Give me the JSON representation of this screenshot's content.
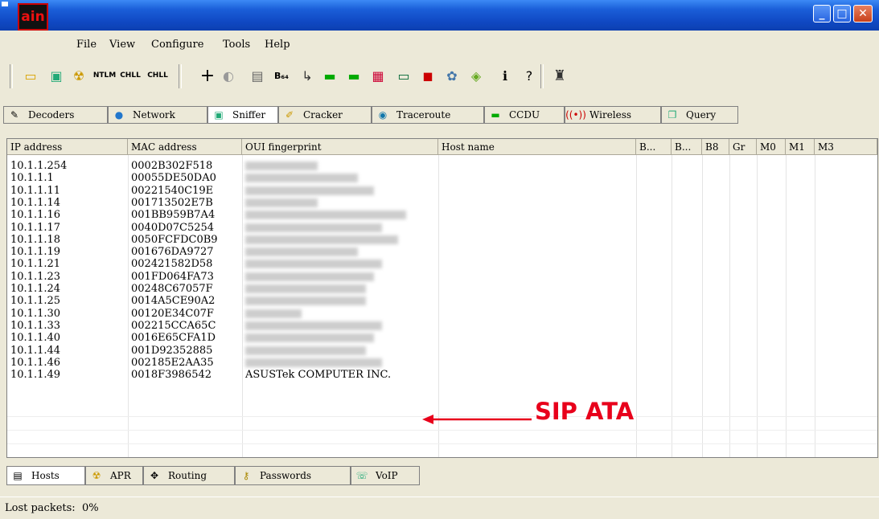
{
  "window": {
    "logo_text": "ain"
  },
  "menu": [
    "File",
    "View",
    "Configure",
    "Tools",
    "Help"
  ],
  "toolbar_icons": [
    "open-folder-icon",
    "network-card-icon",
    "apr-hazard-icon",
    "ntlm-auth-icon",
    "chall-spoof-icon",
    "chall-reset-icon",
    "add-icon",
    "dictionary-icon",
    "hash-calc-icon",
    "base64-icon",
    "traceroute-wizard-icon",
    "lsa-secrets-icon",
    "wireless-icon",
    "pc-icon",
    "terminal-icon",
    "routing-icon",
    "help-ball-icon",
    "clock-icon",
    "info-icon",
    "question-icon",
    "test-icon"
  ],
  "top_tabs": [
    {
      "label": "Decoders",
      "icon": "decoders-icon"
    },
    {
      "label": "Network",
      "icon": "network-globe-icon"
    },
    {
      "label": "Sniffer",
      "icon": "sniffer-icon"
    },
    {
      "label": "Cracker",
      "icon": "cracker-icon"
    },
    {
      "label": "Traceroute",
      "icon": "traceroute-icon"
    },
    {
      "label": "CCDU",
      "icon": "ccdu-icon"
    },
    {
      "label": "Wireless",
      "icon": "wireless-icon"
    },
    {
      "label": "Query",
      "icon": "query-icon"
    }
  ],
  "columns": [
    "IP address",
    "MAC address",
    "OUI fingerprint",
    "Host name",
    "B...",
    "B...",
    "B8",
    "Gr",
    "M0",
    "M1",
    "M3"
  ],
  "rows": [
    {
      "ip": "10.1.1.254",
      "mac": "0002B302F518",
      "oui": ""
    },
    {
      "ip": "10.1.1.1",
      "mac": "00055DE50DA0",
      "oui": ""
    },
    {
      "ip": "10.1.1.11",
      "mac": "00221540C19E",
      "oui": ""
    },
    {
      "ip": "10.1.1.14",
      "mac": "001713502E7B",
      "oui": ""
    },
    {
      "ip": "10.1.1.16",
      "mac": "001BB959B7A4",
      "oui": ""
    },
    {
      "ip": "10.1.1.17",
      "mac": "0040D07C5254",
      "oui": ""
    },
    {
      "ip": "10.1.1.18",
      "mac": "0050FCFDC0B9",
      "oui": ""
    },
    {
      "ip": "10.1.1.19",
      "mac": "001676DA9727",
      "oui": ""
    },
    {
      "ip": "10.1.1.21",
      "mac": "002421582D58",
      "oui": ""
    },
    {
      "ip": "10.1.1.23",
      "mac": "001FD064FA73",
      "oui": ""
    },
    {
      "ip": "10.1.1.24",
      "mac": "00248C67057F",
      "oui": ""
    },
    {
      "ip": "10.1.1.25",
      "mac": "0014A5CE90A2",
      "oui": ""
    },
    {
      "ip": "10.1.1.30",
      "mac": "00120E34C07F",
      "oui": ""
    },
    {
      "ip": "10.1.1.33",
      "mac": "002215CCA65C",
      "oui": ""
    },
    {
      "ip": "10.1.1.40",
      "mac": "0016E65CFA1D",
      "oui": ""
    },
    {
      "ip": "10.1.1.44",
      "mac": "001D92352885",
      "oui": ""
    },
    {
      "ip": "10.1.1.46",
      "mac": "002185E2AA35",
      "oui": ""
    },
    {
      "ip": "10.1.1.49",
      "mac": "0018F3986542",
      "oui": "ASUSTek COMPUTER INC."
    }
  ],
  "annotation": {
    "text": "SIP ATA",
    "color": "#e8001b"
  },
  "bottom_tabs": [
    {
      "label": "Hosts",
      "icon": "hosts-icon"
    },
    {
      "label": "APR",
      "icon": "apr-icon"
    },
    {
      "label": "Routing",
      "icon": "routing-icon"
    },
    {
      "label": "Passwords",
      "icon": "passwords-icon"
    },
    {
      "label": "VoIP",
      "icon": "voip-icon"
    }
  ],
  "status": {
    "text": "Lost packets:  0%"
  }
}
